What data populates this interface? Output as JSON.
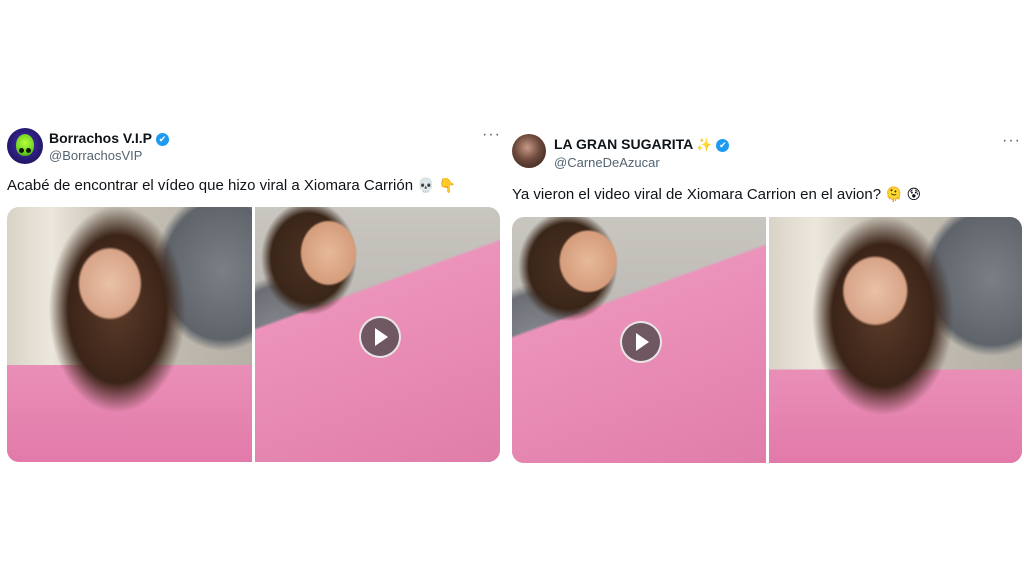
{
  "tweets": [
    {
      "author": "Borrachos V.I.P",
      "handle": "@BorrachosVIP",
      "verified_mark": "✔",
      "text": "Acabé de encontrar el vídeo que hizo viral a Xiomara Carrión",
      "emojis": [
        "💀",
        "👇"
      ],
      "more": "···",
      "media": [
        "photo",
        "video"
      ],
      "avatar_icon": "alien-avatar-icon"
    },
    {
      "author": "LA GRAN SUGARITA",
      "handle": "@CarneDeAzucar",
      "verified_mark": "✔",
      "name_emoji": "✨",
      "text": "Ya vieron el video viral de Xiomara Carrion en el avion?",
      "emojis": [
        "🫠",
        "😰"
      ],
      "more": "···",
      "media": [
        "video",
        "photo"
      ],
      "avatar_icon": "woman-avatar-icon"
    }
  ],
  "colors": {
    "verified": "#1d9bf0",
    "handle": "#536471",
    "text": "#0f1419"
  }
}
